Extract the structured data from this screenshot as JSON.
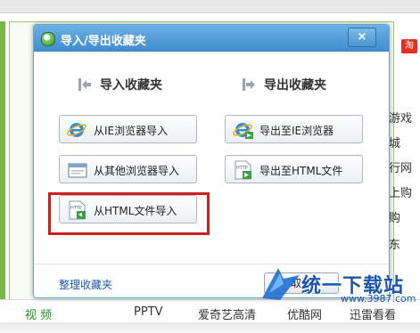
{
  "background": {
    "right_items": [
      "淘",
      "游戏",
      "城",
      "行网",
      "上购",
      "购",
      "东"
    ],
    "bottom_items": [
      "视 频",
      "PPTV",
      "爱奇艺高清",
      "优酷网",
      "迅雷看看"
    ]
  },
  "dialog": {
    "title": "导入/导出收藏夹",
    "close_label": "×",
    "import_section_title": "导入收藏夹",
    "export_section_title": "导出收藏夹",
    "import_buttons": [
      {
        "label": "从IE浏览器导入",
        "icon": "ie-icon"
      },
      {
        "label": "从其他浏览器导入",
        "icon": "browser-window-icon"
      },
      {
        "label": "从HTML文件导入",
        "icon": "html-file-icon"
      }
    ],
    "export_buttons": [
      {
        "label": "导出至IE浏览器",
        "icon": "ie-icon"
      },
      {
        "label": "导出至HTML文件",
        "icon": "html-file-icon"
      }
    ],
    "manage_link": "整理收藏夹",
    "cancel_label": "取消"
  },
  "watermark": {
    "text": "统一下载站",
    "url": "www.3987.com"
  },
  "colors": {
    "title_bar": "#4a94d2",
    "highlight": "#d21d1d",
    "link": "#1a5aa8"
  }
}
